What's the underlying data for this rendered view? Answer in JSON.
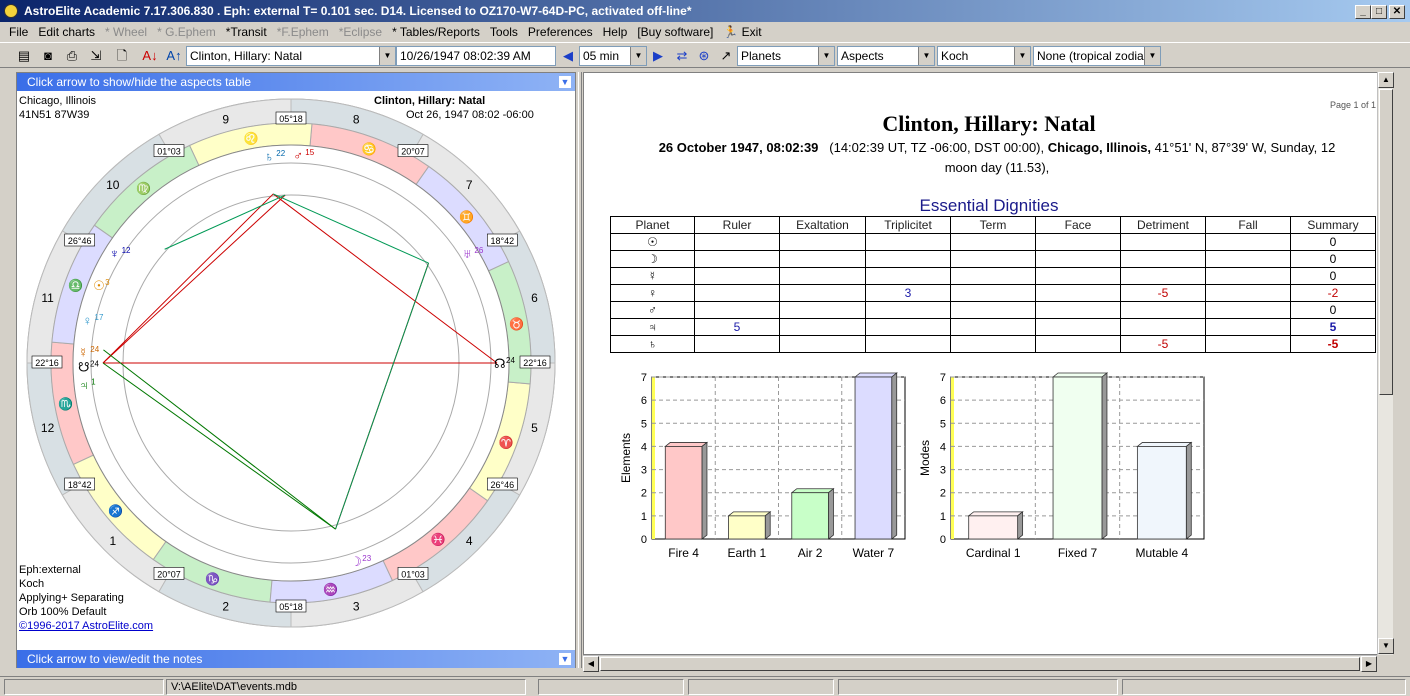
{
  "window": {
    "title": "AstroElite Academic 7.17.306.830 . Eph: external T= 0.101 sec. D14. Licensed to OZ170-W7-64D-PC, activated off-line*",
    "minimize": "_",
    "maximize": "□",
    "close": "✕"
  },
  "menu": {
    "file": "File",
    "edit_charts": "Edit charts",
    "wheel": "* Wheel",
    "g_ephem": "* G.Ephem",
    "transit": "*Transit",
    "f_ephem": "*F.Ephem",
    "eclipse": "*Eclipse",
    "tables_reports": "* Tables/Reports",
    "tools": "Tools",
    "preferences": "Preferences",
    "help": "Help",
    "buy_software": "[Buy software]",
    "exit": "Exit"
  },
  "toolbar": {
    "chart_name": "Clinton, Hillary: Natal",
    "datetime": "10/26/1947   08:02:39 AM",
    "step": "05 min",
    "planets": "Planets",
    "aspects": "Aspects",
    "house_system": "Koch",
    "zodiac": "None (tropical zodiac)"
  },
  "left": {
    "aspects_bar": "Click arrow to show/hide the aspects table",
    "notes_bar": "Click arrow to view/edit the notes",
    "place": "Chicago, Illinois",
    "coords": "41N51 87W39",
    "chart_title": "Clinton, Hillary: Natal",
    "chart_date": "Oct 26, 1947 08:02 -06:00",
    "eph": "Eph:external",
    "house": "Koch",
    "applying": "Applying+ Separating",
    "orb": "Orb 100% Default",
    "copyright": "©1996-2017 AstroElite.com",
    "house_numbers": [
      "10",
      "9",
      "8",
      "7",
      "6",
      "5",
      "4",
      "3",
      "2",
      "1",
      "12",
      "11"
    ],
    "cusp_degrees": [
      "05°18",
      "20°07",
      "18°42",
      "22°16",
      "26°46",
      "01°03",
      "05°18",
      "20°07",
      "18°42",
      "22°16",
      "26°46",
      "01°03"
    ],
    "planet_degrees": {
      "saturn": "22",
      "mars": "15",
      "neptune": "12",
      "uranus": "26",
      "node": "24",
      "moon": "23",
      "sun": "3",
      "venus": "17",
      "mercury": "24",
      "merc2": "24",
      "jupiter": "1"
    }
  },
  "report": {
    "page": "Page 1 of 1",
    "title": "Clinton, Hillary: Natal",
    "date_bold": "26 October 1947, 08:02:39",
    "date_rest": "(14:02:39 UT, TZ -06:00, DST  00:00),",
    "city": "Chicago, Illinois,",
    "location_rest": "41°51' N, 87°39' W, Sunday, 12",
    "moon_day": "moon day (11.53),",
    "section": "Essential Dignities",
    "columns": [
      "Planet",
      "Ruler",
      "Exaltation",
      "Triplicitet",
      "Term",
      "Face",
      "Detriment",
      "Fall",
      "Summary"
    ],
    "rows": [
      {
        "planet": "☉",
        "cells": [
          "",
          "",
          "",
          "",
          "",
          "",
          ""
        ],
        "summary": "0",
        "color": "#000",
        "bold": false
      },
      {
        "planet": "☽",
        "cells": [
          "",
          "",
          "",
          "",
          "",
          "",
          ""
        ],
        "summary": "0",
        "color": "#000",
        "bold": false
      },
      {
        "planet": "☿",
        "cells": [
          "",
          "",
          "",
          "",
          "",
          "",
          ""
        ],
        "summary": "0",
        "color": "#000",
        "bold": false
      },
      {
        "planet": "♀",
        "cells": [
          "",
          "",
          "3",
          "",
          "",
          "-5",
          ""
        ],
        "summary": "-2",
        "color": "#c00000",
        "bold": false
      },
      {
        "planet": "♂",
        "cells": [
          "",
          "",
          "",
          "",
          "",
          "",
          ""
        ],
        "summary": "0",
        "color": "#000",
        "bold": false
      },
      {
        "planet": "♃",
        "cells": [
          "5",
          "",
          "",
          "",
          "",
          "",
          ""
        ],
        "summary": "5",
        "color": "#1a1aa8",
        "bold": true
      },
      {
        "planet": "♄",
        "cells": [
          "",
          "",
          "",
          "",
          "",
          "-5",
          ""
        ],
        "summary": "-5",
        "color": "#c00000",
        "bold": true
      }
    ]
  },
  "chart_data": [
    {
      "type": "bar",
      "ylabel": "Elements",
      "categories": [
        "Fire 4",
        "Earth 1",
        "Air 2",
        "Water 7"
      ],
      "values": [
        4,
        1,
        2,
        7
      ],
      "colors": [
        "#ffc8c8",
        "#ffffc8",
        "#c8ffc8",
        "#dcdcff"
      ],
      "ylim": [
        0,
        7
      ],
      "ticks": [
        "0",
        "1",
        "2",
        "3",
        "4",
        "5",
        "6",
        "7"
      ],
      "grid": true
    },
    {
      "type": "bar",
      "ylabel": "Modes",
      "categories": [
        "Cardinal 1",
        "Fixed 7",
        "Mutable 4"
      ],
      "values": [
        1,
        7,
        4
      ],
      "colors": [
        "#fff0f0",
        "#f0fff0",
        "#f0f6fc"
      ],
      "ylim": [
        0,
        7
      ],
      "ticks": [
        "0",
        "1",
        "2",
        "3",
        "4",
        "5",
        "6",
        "7"
      ],
      "grid": true
    }
  ],
  "status": {
    "path": "V:\\AElite\\DAT\\events.mdb"
  }
}
